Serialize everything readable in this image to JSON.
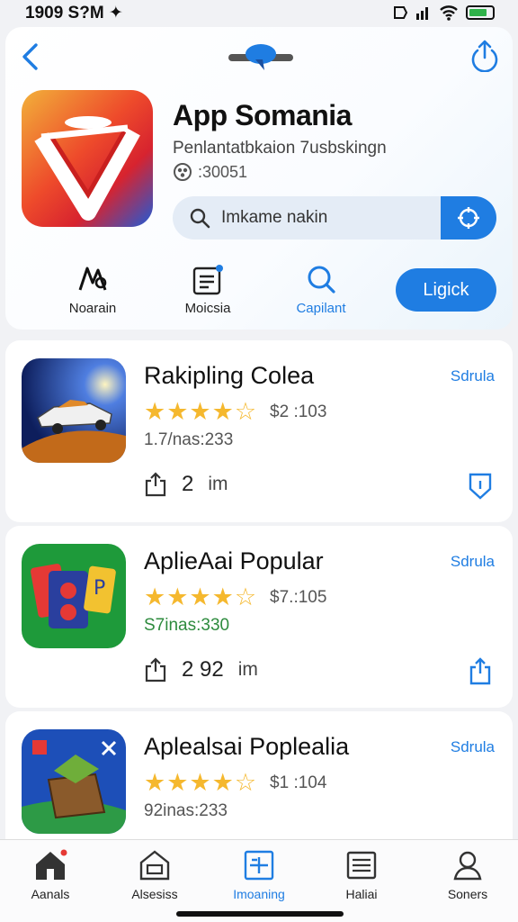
{
  "status_bar": {
    "time": "1909 S?M ✦"
  },
  "header": {
    "app_title": "App Somania",
    "subtitle": "Penlantatbkaion 7usbskingn",
    "meta": ":30051",
    "search": {
      "text": "Imkame nakin"
    },
    "actions": [
      {
        "label": "Noarain",
        "icon": "puzzle-icon"
      },
      {
        "label": "Moicsia",
        "icon": "document-icon"
      },
      {
        "label": "Capilant",
        "icon": "search-icon"
      }
    ],
    "primary_button": "Ligick"
  },
  "apps": [
    {
      "title": "Rakipling Colea",
      "tag": "Sdrula",
      "stars": "★★★★☆",
      "price": "$2 :103",
      "stat": "1.7/nas:233",
      "count": "2",
      "unit": "im",
      "footer_icon": "shield-icon"
    },
    {
      "title": "AplieAai Popular",
      "tag": "Sdrula",
      "stars": "★★★★☆",
      "price": "$7.:105",
      "stat": "S7inas:330",
      "count": "2 92",
      "unit": "im",
      "footer_icon": "share-icon"
    },
    {
      "title": "Aplealsai Poplealia",
      "tag": "Sdrula",
      "stars": "★★★★☆",
      "price": "$1 :104",
      "stat": "92inas:233",
      "count": "",
      "unit": "",
      "footer_icon": ""
    }
  ],
  "tab_bar": [
    {
      "label": "Aanals",
      "icon": "home-icon"
    },
    {
      "label": "Alsesiss",
      "icon": "store-icon"
    },
    {
      "label": "Imoaning",
      "icon": "grid-icon"
    },
    {
      "label": "Haliai",
      "icon": "list-icon"
    },
    {
      "label": "Soners",
      "icon": "profile-icon"
    }
  ],
  "colors": {
    "accent": "#1f7de2",
    "star": "#f5b82e",
    "badge": "#e53935"
  }
}
